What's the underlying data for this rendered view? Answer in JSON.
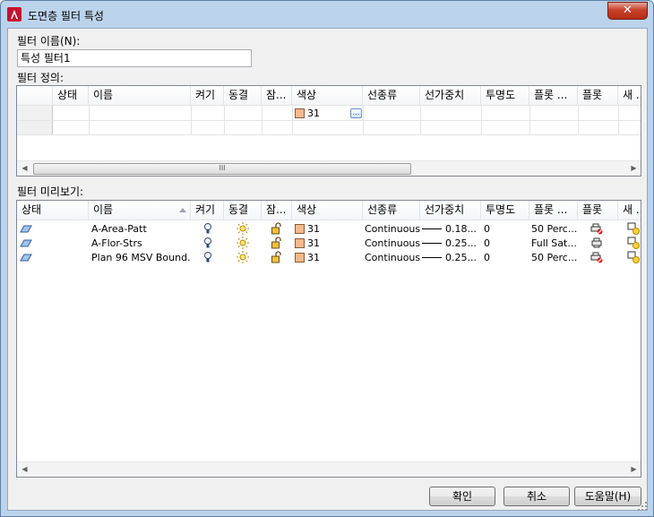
{
  "window": {
    "title": "도면층 필터 특성",
    "close_symbol": "✕"
  },
  "name_section": {
    "label": "필터 이름(N):",
    "value": "특성 필터1"
  },
  "definition": {
    "label": "필터 정의:",
    "columns": [
      "상태",
      "이름",
      "켜기",
      "동결",
      "잠...",
      "색상",
      "선종류",
      "선가중치",
      "투명도",
      "플롯 ...",
      "플롯",
      "새 ..."
    ],
    "row": {
      "color": "31",
      "color_button": "..."
    },
    "scrollbar_thumb": "III"
  },
  "preview": {
    "label": "필터 미리보기:",
    "columns": [
      "상태",
      "이름",
      "켜기",
      "동결",
      "잠...",
      "색상",
      "선종류",
      "선가중치",
      "투명도",
      "플롯 ...",
      "플롯",
      "새 ..."
    ],
    "rows": [
      {
        "name": "A-Area-Patt",
        "color": "31",
        "linetype": "Continuous",
        "lineweight": "0.18...",
        "transparency": "0",
        "plot_style": "50 Perc...",
        "plot_icon": "no-plot-printer-icon"
      },
      {
        "name": "A-Flor-Strs",
        "color": "31",
        "linetype": "Continuous",
        "lineweight": "0.25...",
        "transparency": "0",
        "plot_style": "Full Sat...",
        "plot_icon": "printer-icon"
      },
      {
        "name": "Plan 96 MSV Bound...",
        "color": "31",
        "linetype": "Continuous",
        "lineweight": "0.25...",
        "transparency": "0",
        "plot_style": "50 Perc...",
        "plot_icon": "no-plot-printer-icon"
      }
    ]
  },
  "buttons": {
    "ok": "확인",
    "cancel": "취소",
    "help": "도움말(H)"
  },
  "colors": {
    "accent": "#bcd3ec",
    "swatch": "#f5b98c",
    "close": "#c8412b"
  }
}
